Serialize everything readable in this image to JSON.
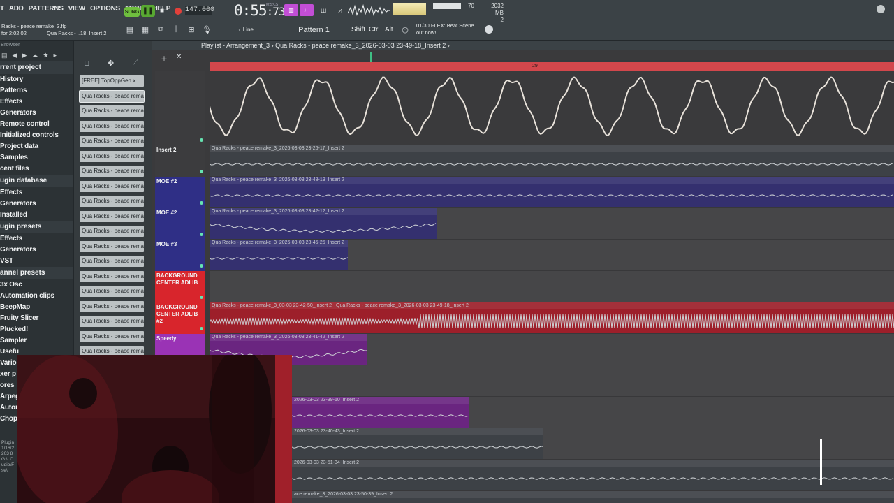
{
  "menu": [
    "T",
    "ADD",
    "PATTERNS",
    "VIEW",
    "OPTIONS",
    "TOOLS",
    "HELP"
  ],
  "transport": {
    "song_label": "SONG",
    "tempo": "147.000",
    "time": "0:55",
    "time_frac": ":73",
    "time_unit": "M:S:CS",
    "cpu_voices": "70",
    "ram_mb": "2032 MB",
    "ram_count": "2"
  },
  "file": {
    "name": "Racks - peace remake_3.flp",
    "duration": "for 2:02:02",
    "hint": "Qua Racks - ..18_Insert 2"
  },
  "toolbar": {
    "snap": "Line",
    "pattern": "Pattern 1",
    "mod_keys": [
      "Shift",
      "Ctrl",
      "Alt"
    ],
    "news": [
      "01/30  FLEX: Beat Scene",
      "out now!"
    ]
  },
  "browser": {
    "title": "Browser",
    "items": [
      {
        "label": "rrent project",
        "head": true
      },
      {
        "label": "History"
      },
      {
        "label": "Patterns"
      },
      {
        "label": "Effects"
      },
      {
        "label": "Generators"
      },
      {
        "label": "Remote control"
      },
      {
        "label": "Initialized controls"
      },
      {
        "label": "Project data"
      },
      {
        "label": "Samples"
      },
      {
        "label": "cent files"
      },
      {
        "label": "ugin database",
        "head": true
      },
      {
        "label": "Effects"
      },
      {
        "label": "Generators"
      },
      {
        "label": "Installed"
      },
      {
        "label": "ugin presets",
        "head": true
      },
      {
        "label": "Effects"
      },
      {
        "label": "Generators"
      },
      {
        "label": "VST"
      },
      {
        "label": "annel presets",
        "head": true
      },
      {
        "label": "3x Osc"
      },
      {
        "label": "Automation clips"
      },
      {
        "label": "BeepMap"
      },
      {
        "label": "Fruity Slicer"
      },
      {
        "label": "Plucked!"
      },
      {
        "label": "Sampler"
      },
      {
        "label": "Usefu"
      },
      {
        "label": "Vario"
      },
      {
        "label": "xer p"
      },
      {
        "label": "ores"
      },
      {
        "label": "Arpeg"
      },
      {
        "label": "Autom"
      },
      {
        "label": "Chopp"
      }
    ],
    "footer": [
      "Plugin",
      "1/16/2",
      "203 8",
      "G:\\LO",
      "udio\\F",
      "se\\"
    ]
  },
  "channels": [
    "[FREE] TopOppGen x..",
    "Qua Racks - peace remak..",
    "Qua Racks - peace remak..",
    "Qua Racks - peace remak..",
    "Qua Racks - peace remak..",
    "Qua Racks - peace remak..",
    "Qua Racks - peace remak..",
    "Qua Racks - peace remak..",
    "Qua Racks - peace remak..",
    "Qua Racks - peace remak..",
    "Qua Racks - peace remak..",
    "Qua Racks - peace remak..",
    "Qua Racks - peace remak..",
    "Qua Racks - peace remak..",
    "Qua Racks - peace remak..",
    "Qua Racks - peace remak..",
    "Qua Racks - peace remak..",
    "Qua Racks - peace remak..",
    "Qua Racks - peace remak..",
    "Qua Racks - peace remak..",
    "Qua Racks - peace remak.."
  ],
  "playlist": {
    "title": "Playlist - Arrangement_3",
    "breadcrumb": "Qua Racks - peace remake_3_2026-03-03 23-49-18_Insert 2",
    "ruler_bar": "29",
    "tracks": [
      {
        "name": "",
        "color": "#3c3c3e",
        "clip": "",
        "clip_color": "#3a3a3c"
      },
      {
        "name": "Insert 2",
        "color": "#3c3c3e",
        "clip": "Qua Racks - peace remake_3_2026-03-03 23-26-17_Insert 2",
        "clip_color": "#3d4146"
      },
      {
        "name": "MOE #2",
        "color": "#2f2f86",
        "clip": "Qua Racks - peace remake_3_2026-03-03 23-48-19_Insert 2",
        "clip_color": "#34306f"
      },
      {
        "name": "MOE #2",
        "color": "#2f2f86",
        "clip": "Qua Racks - peace remake_3_2026-03-03 23-42-12_Insert 2",
        "clip_color": "#34306f"
      },
      {
        "name": "MOE #3",
        "color": "#2f2f86",
        "clip": "Qua Racks - peace remake_3_2026-03-03 23-45-25_Insert 2",
        "clip_color": "#34306f"
      },
      {
        "name": "BACKGROUND CENTER ADLIB",
        "color": "#d8252c",
        "clip": "",
        "clip_color": "#7b1e24"
      },
      {
        "name": "BACKGROUND CENTER ADLIB #2",
        "color": "#d8252c",
        "clip": "Qua Racks - peace remake_3_03-03 23-42-50_Insert 2",
        "clip2": "Qua Racks - peace remake_3_2026-03-03 23-49-18_Insert 2",
        "clip_color": "#9d1f2a"
      },
      {
        "name": "Speedy",
        "color": "#9a33b5",
        "clip": "Qua Racks - peace remake_3_2026-03-03 23-41-42_Insert 2",
        "clip_color": "#6a2580"
      },
      {
        "name": "",
        "color": "#3c3c3e",
        "clip": "",
        "clip_color": "#3a3a3c"
      },
      {
        "name": "",
        "color": "#3c3c3e",
        "clip": "2026-03-03 23-39-10_Insert 2",
        "clip_color": "#6a2580"
      },
      {
        "name": "",
        "color": "#3c3c3e",
        "clip": "2026-03-03 23-40-43_Insert 2",
        "clip_color": "#3d4146"
      },
      {
        "name": "",
        "color": "#3c3c3e",
        "clip": "2026-03-03 23-51-34_Insert 2",
        "clip_color": "#3d4146"
      },
      {
        "name": "",
        "color": "#3c3c3e",
        "clip": "ace remake_3_2026-03-03 23-50-39_Insert 2",
        "clip_color": "#3d4146"
      }
    ]
  }
}
